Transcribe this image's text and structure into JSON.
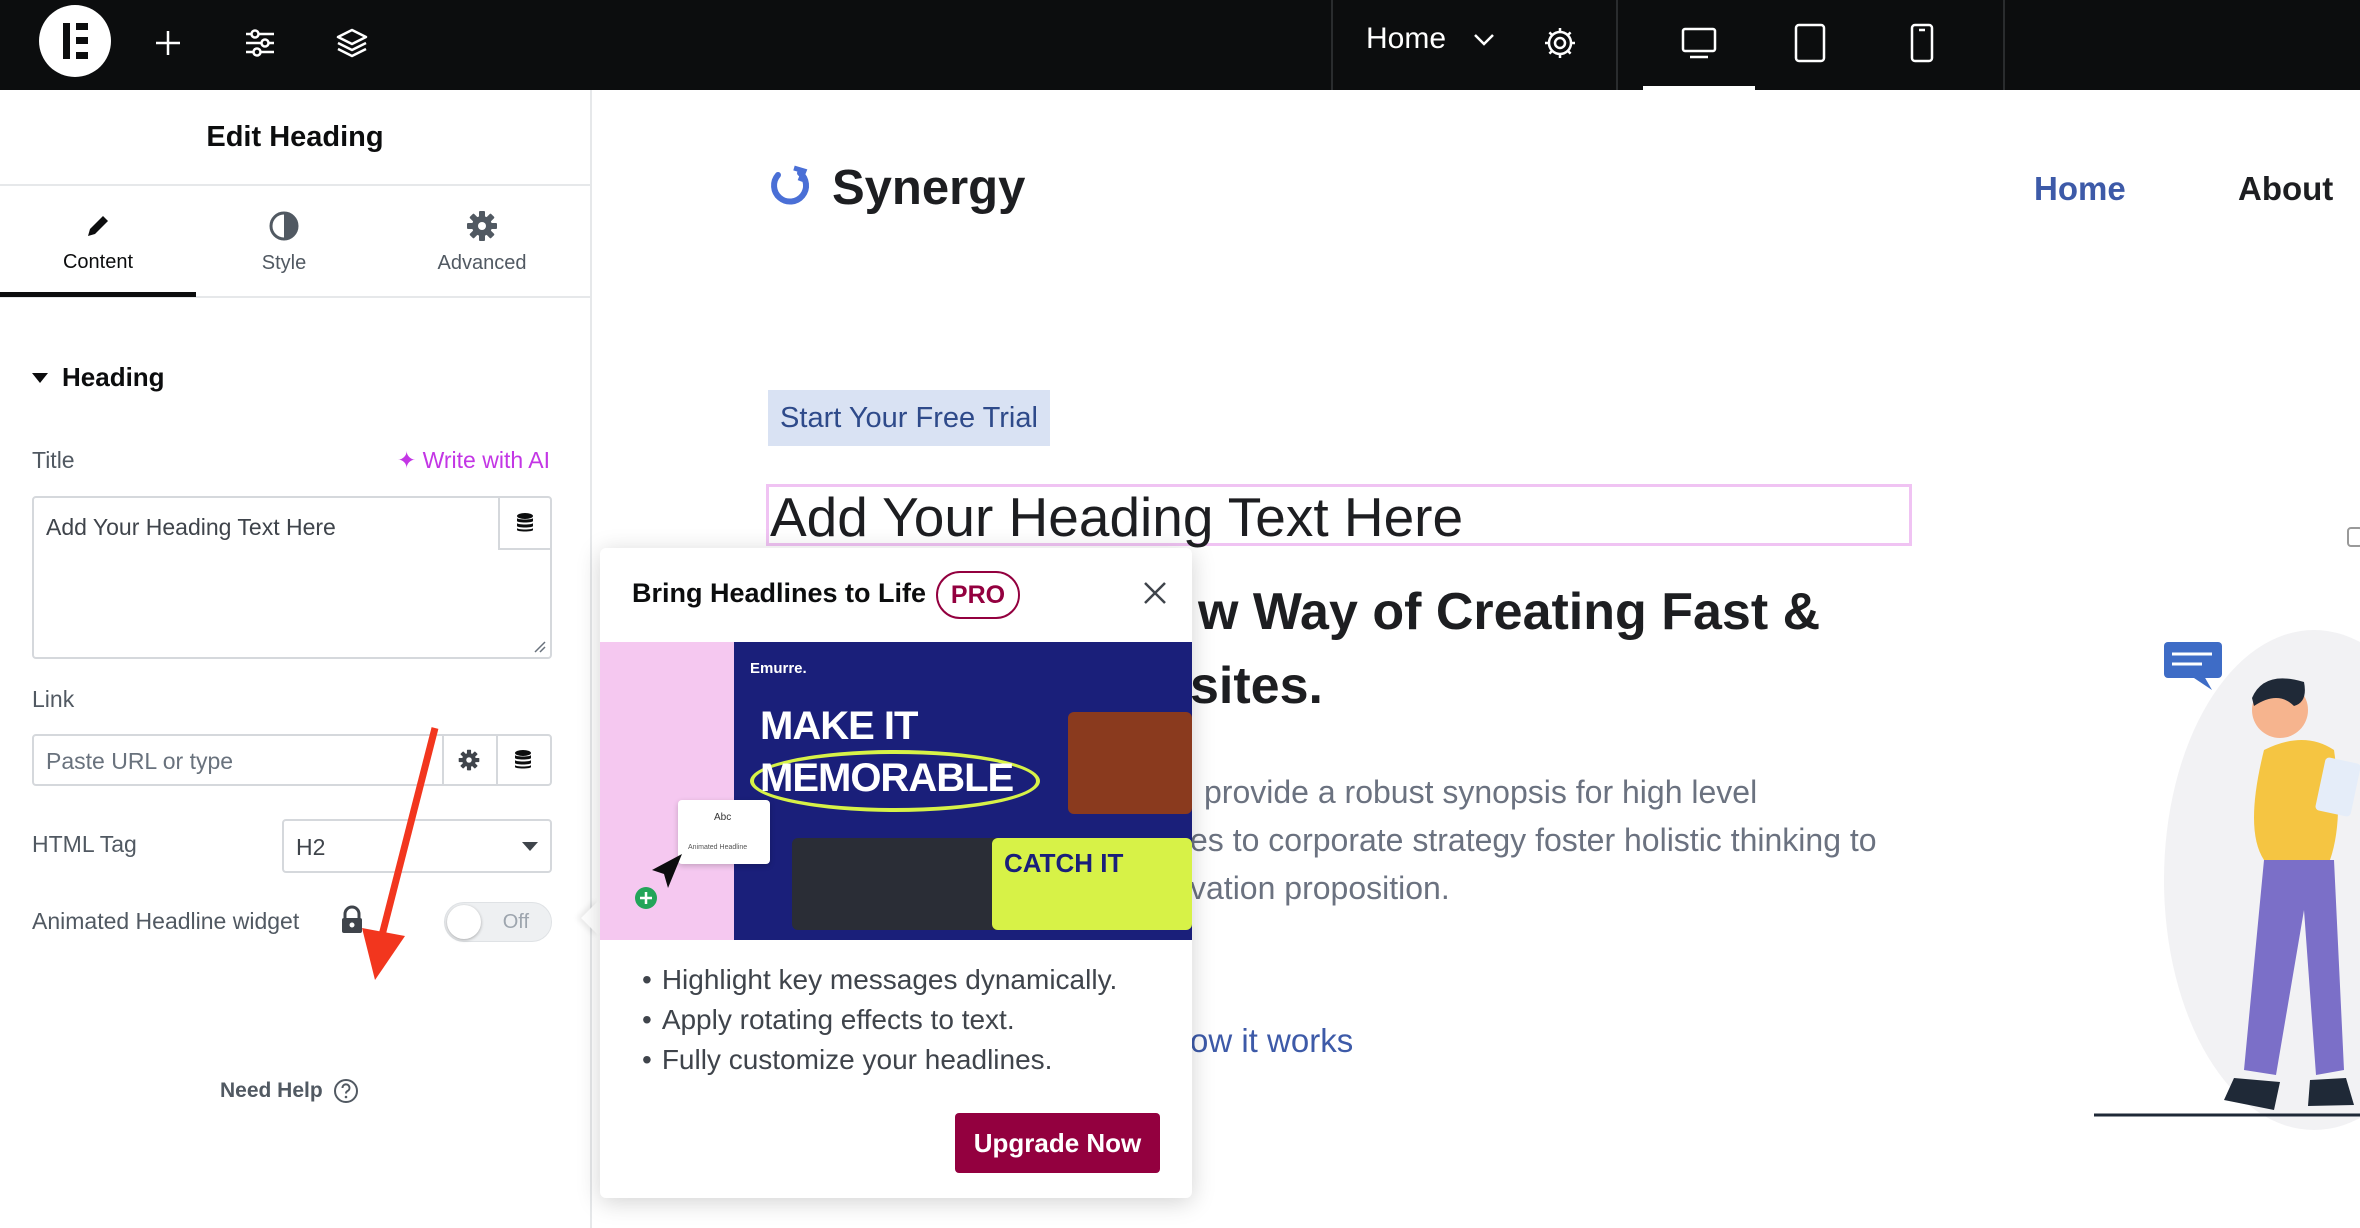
{
  "topbar": {
    "page_selector": "Home",
    "icons": [
      "elementor-logo-icon",
      "plus-icon",
      "sliders-icon",
      "layers-icon",
      "chevron-down-icon",
      "gear-icon",
      "desktop-icon",
      "tablet-icon",
      "mobile-icon"
    ]
  },
  "panel": {
    "title": "Edit Heading",
    "tabs": [
      {
        "label": "Content",
        "icon": "pencil-icon"
      },
      {
        "label": "Style",
        "icon": "contrast-icon"
      },
      {
        "label": "Advanced",
        "icon": "gear-icon"
      }
    ],
    "section": "Heading",
    "title_label": "Title",
    "ai_link": "Write with AI",
    "title_value": "Add Your Heading Text Here",
    "link_label": "Link",
    "link_placeholder": "Paste URL or type",
    "html_tag_label": "HTML Tag",
    "html_tag_value": "H2",
    "animated_label": "Animated Headline widget",
    "toggle_state": "Off",
    "need_help": "Need Help"
  },
  "canvas": {
    "brand": "Synergy",
    "nav": [
      "Home",
      "About"
    ],
    "trial_button": "Start Your Free Trial",
    "heading": "Add Your Heading Text Here",
    "subheading_line1": "w Way of Creating Fast &",
    "subheading_line2": "sites.",
    "para_line1": "provide a robust synopsis for high level",
    "para_line2": "es to corporate strategy foster holistic thinking to",
    "para_line3": "vation proposition.",
    "how_link": "ow it works"
  },
  "popup": {
    "title": "Bring Headlines to Life",
    "badge": "PRO",
    "bullets": [
      "Highlight key messages dynamically.",
      "Apply rotating effects to text.",
      "Fully customize your headlines."
    ],
    "cta": "Upgrade Now",
    "image": {
      "brand": "Emurre.",
      "headline_1": "MAKE IT",
      "headline_2": "MEMORABLE",
      "card_text": "CATCH IT",
      "widget_label": "Animated Headline",
      "widget_sample": "Abc"
    }
  },
  "colors": {
    "accent_ai": "#c336e5",
    "pro": "#93003f",
    "link_blue": "#3d5aa8",
    "selection": "#f0c3f3",
    "annotation_arrow": "#f2361e"
  }
}
